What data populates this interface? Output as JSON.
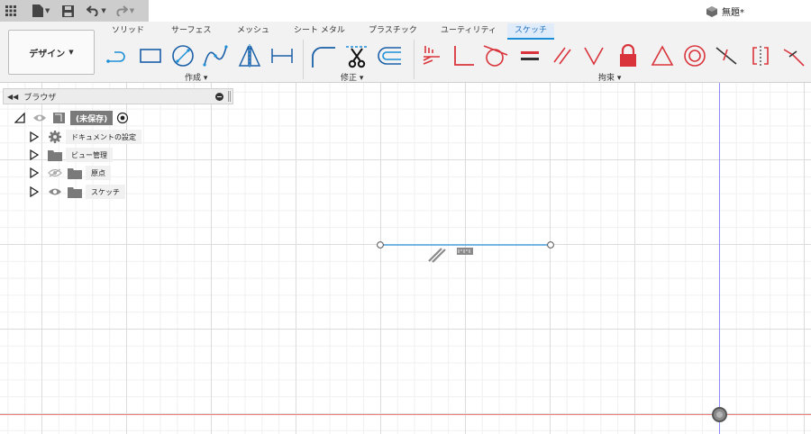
{
  "app": {
    "document_title": "無題*"
  },
  "ribbon": {
    "workspace_label": "デザイン",
    "tabs": [
      {
        "label": "ソリッド",
        "active": false
      },
      {
        "label": "サーフェス",
        "active": false
      },
      {
        "label": "メッシュ",
        "active": false
      },
      {
        "label": "シート メタル",
        "active": false
      },
      {
        "label": "プラスチック",
        "active": false
      },
      {
        "label": "ユーティリティ",
        "active": false
      },
      {
        "label": "スケッチ",
        "active": true
      }
    ],
    "groups": {
      "create": "作成 ▾",
      "modify": "修正 ▾",
      "constraints": "拘束 ▾"
    }
  },
  "browser": {
    "title": "ブラウザ",
    "root": "(未保存)",
    "items": [
      {
        "label": "ドキュメントの設定",
        "icon": "gear-icon"
      },
      {
        "label": "ビュー管理",
        "icon": "folder-icon"
      },
      {
        "label": "原点",
        "icon": "folder-icon"
      },
      {
        "label": "スケッチ",
        "icon": "folder-icon"
      }
    ]
  },
  "colors": {
    "accent": "#1a8fd8",
    "constraint_red": "#d9343b",
    "axis_x": "#f08080",
    "axis_y": "#8c8cff",
    "sketch_line": "#4aa3df"
  }
}
